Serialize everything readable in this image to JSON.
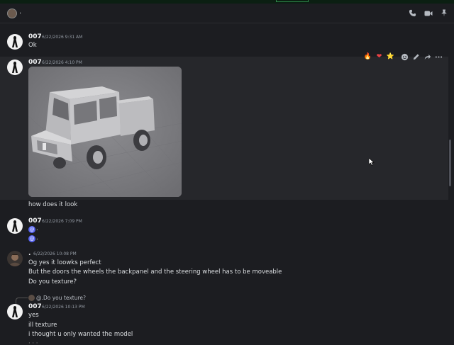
{
  "header": {
    "channel_name": ".",
    "icons": [
      "phone-call-icon",
      "video-icon",
      "pin-icon"
    ]
  },
  "messages": [
    {
      "author": "007",
      "timestamp": "6/22/2026 9:31 AM",
      "lines": [
        "Ok"
      ]
    },
    {
      "author": "007",
      "timestamp": "6/22/2026 4:10 PM",
      "attachment": "image",
      "lines": [
        "how does it look"
      ]
    },
    {
      "author": "007",
      "timestamp": "6/22/2026 7:09 PM",
      "mentions": 2
    },
    {
      "author": ".",
      "timestamp": "6/22/2026 10:08 PM",
      "lines": [
        "Og yes it loowks perfect",
        "But the doors the wheels the backpanel and the steering wheel has to be moveable",
        "Do you texture?"
      ]
    },
    {
      "author": "007",
      "timestamp": "6/22/2026 10:13 PM",
      "reply": {
        "author": "@.",
        "text": "Do you texture?"
      },
      "lines": [
        "yes",
        "ill texture",
        "i thought u only wanted the model"
      ]
    }
  ],
  "reactions": [
    "🔥",
    "❤",
    "⭐"
  ],
  "colors": {
    "background": "#1c1d21",
    "hover": "#26272b",
    "mention": "#5865f2"
  }
}
